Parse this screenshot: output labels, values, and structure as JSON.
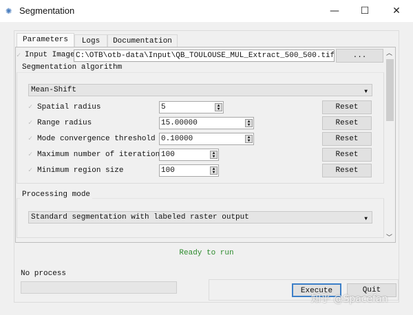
{
  "window": {
    "title": "Segmentation",
    "minimize": "—",
    "maximize": "☐",
    "close": "✕",
    "icon": "gear-icon"
  },
  "tabs": [
    {
      "label": "Parameters",
      "selected": true
    },
    {
      "label": "Logs"
    },
    {
      "label": "Documentation"
    }
  ],
  "input_image": {
    "label": "Input Image",
    "value": "C:\\OTB\\otb-data\\Input\\QB_TOULOUSE_MUL_Extract_500_500.tif",
    "browse": "..."
  },
  "segmentation": {
    "group_label": "Segmentation algorithm",
    "algorithm": "Mean-Shift",
    "params": [
      {
        "label": "Spatial radius",
        "value": "5",
        "reset": "Reset"
      },
      {
        "label": "Range radius",
        "value": "15.00000",
        "reset": "Reset"
      },
      {
        "label": "Mode convergence threshold",
        "value": "0.10000",
        "reset": "Reset"
      },
      {
        "label": "Maximum number of iterations",
        "value": "100",
        "reset": "Reset"
      },
      {
        "label": "Minimum region size",
        "value": "100",
        "reset": "Reset"
      }
    ]
  },
  "processing": {
    "group_label": "Processing mode",
    "mode": "Standard segmentation with labeled raster output"
  },
  "status": {
    "text": "Ready to run",
    "color": "#2e8b2e"
  },
  "progress": {
    "label": "No process",
    "value": 0
  },
  "actions": {
    "execute": "Execute",
    "quit": "Quit"
  },
  "watermark": "知乎 @Spacefan"
}
